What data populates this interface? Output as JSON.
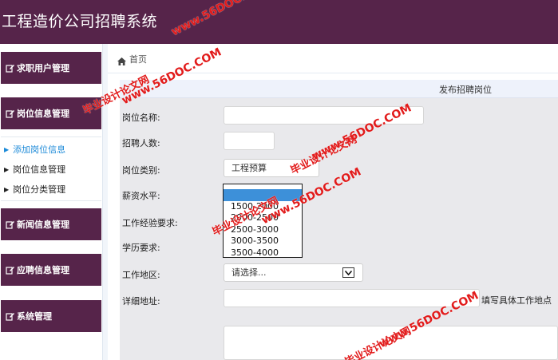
{
  "header": {
    "title": "工程造价公司招聘系统"
  },
  "breadcrumb": {
    "text": "首页"
  },
  "sidebar": {
    "menus": [
      {
        "label": "求职用户管理"
      },
      {
        "label": "岗位信息管理"
      },
      {
        "label": "新闻信息管理"
      },
      {
        "label": "应聘信息管理"
      },
      {
        "label": "系统管理"
      }
    ],
    "submenu": [
      {
        "label": "添加岗位信息",
        "active": true
      },
      {
        "label": "岗位信息管理"
      },
      {
        "label": "岗位分类管理"
      }
    ]
  },
  "form": {
    "title": "发布招聘岗位",
    "labels": {
      "position_name": "岗位名称:",
      "headcount": "招聘人数:",
      "category": "岗位类别:",
      "salary": "薪资水平:",
      "experience": "工作经验要求:",
      "education": "学历要求:",
      "region": "工作地区:",
      "address": "详细地址:"
    },
    "category_value": "工程预算",
    "region_value": "请选择...",
    "address_hint": "填写具体工作地点",
    "salary_options": [
      "",
      "1500-2000",
      "2000-2500",
      "2500-3000",
      "3000-3500",
      "3500-4000"
    ]
  },
  "watermarks": [
    "www.56DOC.COM",
    "毕业设计论文网",
    "www.56DOC.COM",
    "毕业设计论文网",
    "www.56DOC.COM",
    "毕业设计论文网",
    "www.56DOC.COM",
    "毕业设计论文网",
    "www.56DOC.COM"
  ],
  "colors": {
    "brand": "#56244a",
    "active_link": "#1c8ad8",
    "selected_option": "#3d90d9",
    "watermark": "#e21b1b"
  }
}
